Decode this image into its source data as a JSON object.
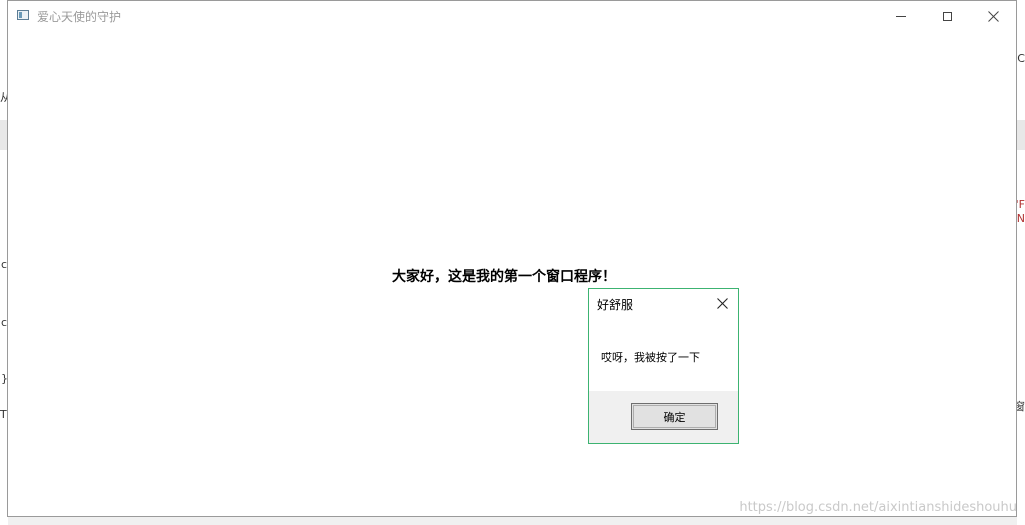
{
  "window": {
    "title": "爱心天使的守护",
    "main_label": "大家好，这是我的第一个窗口程序！"
  },
  "dialog": {
    "title": "好舒服",
    "message": "哎呀，我被按了一下",
    "ok_label": "确定"
  },
  "watermark": "https://blog.csdn.net/aixintianshideshouhu",
  "background": {
    "left_fragments": [
      "从",
      "c",
      "c",
      "}",
      "T"
    ],
    "right_fragments": [
      "EC",
      "'F",
      "EN",
      "窗"
    ]
  },
  "colors": {
    "dialog_border": "#3cb371",
    "window_border": "#9a9a9a",
    "footer_bg": "#f0f0f0"
  },
  "icons": [
    "app-icon",
    "minimize-icon",
    "maximize-icon",
    "close-icon"
  ]
}
